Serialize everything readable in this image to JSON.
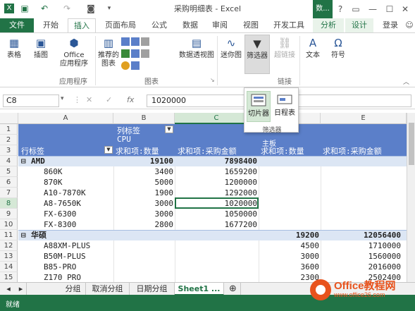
{
  "window": {
    "title": "采购明细表 - Excel",
    "help": "?",
    "login": "登录"
  },
  "tabs": {
    "file": "文件",
    "items": [
      "开始",
      "插入",
      "页面布局",
      "公式",
      "数据",
      "审阅",
      "视图",
      "开发工具"
    ],
    "active": "插入",
    "context_group": "数...",
    "context_tabs": [
      "分析",
      "设计"
    ]
  },
  "ribbon": {
    "table": "表格",
    "illustrations": "插图",
    "office_apps": "Office\n应用程序",
    "recommended_charts": "推荐的\n图表",
    "pivot_chart": "数据透视图",
    "sparklines": "迷你图",
    "filters": "筛选器",
    "hyperlink": "超链接",
    "text": "文本",
    "symbol": "符号",
    "group_apps": "应用程序",
    "group_charts": "图表",
    "group_links": "链接"
  },
  "dropdown": {
    "slicer": "切片器",
    "timeline": "日程表",
    "group_label": "筛选器"
  },
  "formula_bar": {
    "name_box": "C8",
    "fx": "fx",
    "value": "1020000"
  },
  "columns": [
    "A",
    "B",
    "C",
    "D",
    "E"
  ],
  "rows": [
    "1",
    "2",
    "3",
    "4",
    "5",
    "6",
    "7",
    "8",
    "9",
    "10",
    "11",
    "12",
    "13",
    "14",
    "15"
  ],
  "pivot": {
    "col_label": "列标签",
    "cpu": "CPU",
    "board": "主板",
    "row_label": "行标签",
    "sum_qty": "求和项:数量",
    "sum_amt": "求和项:采购金额",
    "groups": [
      {
        "name": "AMD",
        "qty": "19100",
        "amt": "7898400",
        "items": [
          {
            "name": "860K",
            "qty": "3400",
            "amt": "1659200"
          },
          {
            "name": "870K",
            "qty": "5000",
            "amt": "1200000"
          },
          {
            "name": "A10-7870K",
            "qty": "1900",
            "amt": "1292000"
          },
          {
            "name": "A8-7650K",
            "qty": "3000",
            "amt": "1020000"
          },
          {
            "name": "FX-6300",
            "qty": "3000",
            "amt": "1050000"
          },
          {
            "name": "FX-8300",
            "qty": "2800",
            "amt": "1677200"
          }
        ]
      },
      {
        "name": "华硕",
        "qty2": "19200",
        "amt2": "12056400",
        "items": [
          {
            "name": "A88XM-PLUS",
            "qty2": "4500",
            "amt2": "1710000"
          },
          {
            "name": "B50M-PLUS",
            "qty2": "3000",
            "amt2": "1560000"
          },
          {
            "name": "B85-PRO",
            "qty2": "3600",
            "amt2": "2016000"
          },
          {
            "name": "Z170 PRO",
            "qty2": "2300",
            "amt2": "2502400"
          }
        ]
      }
    ]
  },
  "sheet_tabs": [
    "分组",
    "取消分组",
    "日期分组",
    "Sheet1 ..."
  ],
  "status": "就绪",
  "watermark": {
    "brand": "Office教程网",
    "url": "www.office26.com"
  }
}
